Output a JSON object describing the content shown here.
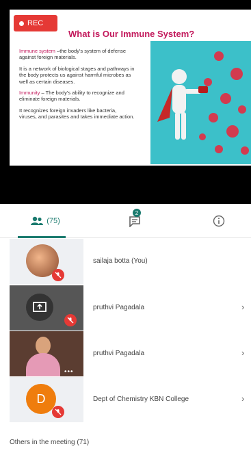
{
  "recording": {
    "label": "REC"
  },
  "slide": {
    "title": "What is Our Immune System?",
    "paragraphs": [
      {
        "highlight": "Immune system",
        "text": " –the body's system of defense against foreign materials."
      },
      {
        "highlight": "",
        "text": "It is a network of biological stages and pathways in the body protects us against harmful microbes as well as certain diseases."
      },
      {
        "highlight": "Immunity",
        "text": " – The body's ability to recognize and eliminate foreign materials."
      },
      {
        "highlight": "",
        "text": "It recognizes foreign invaders like bacteria, viruses, and parasites and takes immediate action."
      }
    ]
  },
  "tabs": {
    "people_count": "(75)",
    "chat_badge": "2"
  },
  "participants": [
    {
      "name": "sailaja botta (You)"
    },
    {
      "name": "pruthvi Pagadala"
    },
    {
      "name": "pruthvi Pagadala"
    },
    {
      "name": "Dept of Chemistry KBN College",
      "initial": "D"
    }
  ],
  "others": {
    "label": "Others in the meeting (71)"
  },
  "colors": {
    "accent": "#1a7a6e",
    "rec": "#e53935",
    "title": "#c2185b",
    "avatar_orange": "#ef7d0d"
  }
}
